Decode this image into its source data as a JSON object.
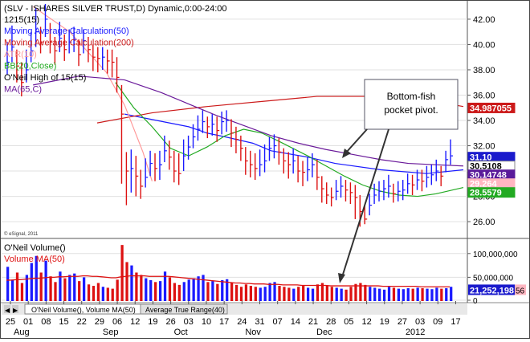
{
  "chart_data": {
    "type": "line",
    "title": "(SLV - ISHARES SILVER TRUST,D) Dynamic,0:00-24:00",
    "header_line2": "1215(15)",
    "price_axis": {
      "min": 24.8,
      "max": 43.2,
      "ticks": [
        "42.00",
        "40.00",
        "38.00",
        "36.00",
        "34.00",
        "32.00",
        "30.00",
        "28.00",
        "26.00"
      ],
      "tick_values": [
        42,
        40,
        38,
        36,
        34,
        32,
        30,
        28,
        26
      ]
    },
    "volume_axis": {
      "min": 0,
      "max": 125000000,
      "ticks": [
        "100,000,000",
        "50,000,000",
        "0"
      ],
      "tick_values": [
        100000000,
        50000000,
        0
      ]
    },
    "x_day_labels": [
      "25",
      "01",
      "08",
      "15",
      "22",
      "29",
      "06",
      "12",
      "19",
      "26",
      "03",
      "10",
      "17",
      "24",
      "31",
      "07",
      "14",
      "21",
      "28",
      "05",
      "12",
      "19",
      "27",
      "03",
      "09",
      "17"
    ],
    "x_month_labels": [
      "Aug",
      "Sep",
      "Oct",
      "Nov",
      "Dec",
      "2012"
    ],
    "x_month_label_slots": [
      0,
      5,
      9,
      13,
      17,
      22
    ],
    "legend": [
      {
        "name": "Moving Average Calculation(50)",
        "color": "#1a1aff"
      },
      {
        "name": "Moving Average Calculation(200)",
        "color": "#cc1a1a"
      },
      {
        "name": "ATR(10)",
        "color": "#ff9999"
      },
      {
        "name": "BB(20,Close)",
        "color": "#22aa22"
      },
      {
        "name": "O'Neil High of 15(15)",
        "color": "#000000"
      },
      {
        "name": "MA(65,C)",
        "color": "#6a1a9a"
      }
    ],
    "series": [
      {
        "name": "Moving Average Calculation(50)",
        "color": "#1a1aff",
        "x": [
          26,
          40,
          44,
          48,
          54,
          58,
          66,
          72,
          82,
          92,
          100
        ],
        "y": [
          34.5,
          33.5,
          33.0,
          32.7,
          32.2,
          31.6,
          31.1,
          30.6,
          30.1,
          29.8,
          30.1
        ]
      },
      {
        "name": "Moving Average Calculation(200)",
        "color": "#cc1a1a",
        "x": [
          20,
          32,
          44,
          56,
          68,
          80,
          92,
          100
        ],
        "y": [
          33.8,
          34.6,
          35.1,
          35.5,
          35.9,
          35.9,
          35.6,
          35.1
        ]
      },
      {
        "name": "ATR(10)",
        "color": "#ff9999",
        "x": [
          6,
          14,
          22,
          26,
          30,
          32
        ],
        "y": [
          43.0,
          41.0,
          37.8,
          35.2,
          31.5,
          29.2
        ]
      },
      {
        "name": "BB(20,Close)",
        "color": "#22aa22",
        "x": [
          24,
          28,
          32,
          36,
          40,
          44,
          48,
          52,
          56,
          60,
          66,
          70,
          74,
          78,
          82,
          86,
          90,
          94,
          100
        ],
        "y": [
          37.0,
          35.0,
          33.5,
          31.8,
          31.2,
          31.9,
          32.8,
          33.3,
          33.0,
          32.3,
          31.2,
          30.4,
          29.6,
          28.9,
          28.4,
          28.1,
          28.0,
          28.2,
          28.7
        ]
      },
      {
        "name": "MA(65,C)",
        "color": "#6a1a9a",
        "x": [
          6,
          16,
          26,
          34,
          40,
          46,
          52,
          58,
          64,
          70,
          76,
          82,
          88,
          94,
          100
        ],
        "y": [
          36.8,
          37.5,
          37.2,
          36.2,
          35.3,
          34.4,
          33.6,
          32.8,
          32.2,
          31.7,
          31.3,
          30.9,
          30.6,
          30.5,
          30.4
        ]
      }
    ],
    "price_bars": {
      "x": [
        0,
        1,
        2,
        3,
        4,
        5,
        6,
        7,
        8,
        9,
        10,
        11,
        12,
        13,
        14,
        15,
        16,
        17,
        18,
        19,
        20,
        21,
        22,
        23,
        24,
        25,
        26,
        27,
        28,
        29,
        30,
        31,
        32,
        33,
        34,
        35,
        36,
        37,
        38,
        39,
        40,
        41,
        42,
        43,
        44,
        45,
        46,
        47,
        48,
        49,
        50,
        51,
        52,
        53,
        54,
        55,
        56,
        57,
        58,
        59,
        60,
        61,
        62,
        63,
        64,
        65,
        66,
        67,
        68,
        69,
        70,
        71,
        72,
        73,
        74,
        75,
        76,
        77,
        78,
        79,
        80,
        81,
        82,
        83,
        84,
        85,
        86,
        87,
        88,
        89,
        90,
        91,
        92,
        93,
        94,
        95,
        96,
        97,
        98,
        99,
        100
      ],
      "close": [
        38.6,
        39.8,
        38.3,
        37.0,
        38.0,
        39.5,
        41.0,
        40.2,
        42.0,
        40.2,
        39.5,
        40.5,
        39.6,
        40.2,
        40.4,
        39.2,
        40.3,
        39.6,
        39.0,
        38.9,
        39.0,
        38.7,
        38.6,
        37.4,
        34.5,
        30.0,
        30.2,
        29.6,
        28.8,
        29.5,
        30.6,
        30.2,
        30.5,
        31.6,
        31.1,
        30.0,
        29.8,
        31.2,
        31.9,
        32.7,
        33.3,
        33.9,
        33.5,
        33.7,
        33.2,
        33.9,
        34.0,
        33.0,
        32.5,
        31.8,
        30.8,
        30.5,
        30.2,
        30.5,
        30.8,
        31.8,
        32.0,
        31.5,
        30.8,
        30.5,
        30.8,
        30.0,
        29.9,
        30.1,
        30.5,
        29.5,
        28.6,
        28.1,
        27.9,
        28.4,
        28.8,
        28.5,
        28.3,
        27.9,
        26.8,
        26.2,
        27.3,
        28.1,
        28.4,
        28.6,
        28.8,
        28.2,
        28.4,
        28.5,
        29.0,
        28.9,
        29.3,
        29.2,
        29.5,
        29.7,
        30.0,
        29.6,
        30.9,
        31.2
      ],
      "high": [
        40.2,
        41.5,
        39.6,
        38.6,
        39.6,
        41.0,
        42.9,
        41.4,
        43.2,
        41.7,
        40.6,
        41.8,
        40.8,
        41.2,
        41.4,
        40.4,
        41.2,
        40.6,
        40.0,
        39.8,
        39.8,
        39.6,
        39.6,
        39.0,
        36.8,
        31.5,
        31.7,
        31.2,
        30.1,
        31.0,
        31.6,
        31.4,
        31.6,
        32.8,
        32.4,
        31.6,
        31.4,
        32.5,
        32.8,
        33.7,
        34.4,
        34.8,
        34.3,
        34.5,
        34.3,
        34.7,
        34.8,
        34.1,
        33.5,
        32.8,
        31.9,
        31.6,
        31.4,
        31.7,
        32.1,
        32.7,
        32.9,
        32.6,
        31.8,
        31.5,
        31.8,
        31.2,
        30.8,
        31.1,
        31.4,
        30.9,
        29.6,
        29.1,
        28.7,
        29.3,
        29.6,
        29.3,
        29.1,
        28.9,
        28.1,
        27.3,
        28.2,
        29.0,
        29.2,
        29.3,
        29.7,
        29.0,
        29.2,
        29.3,
        29.8,
        29.7,
        30.1,
        30.1,
        30.4,
        30.5,
        30.9,
        30.4,
        31.6,
        32.5
      ],
      "low": [
        37.6,
        38.6,
        37.0,
        35.9,
        37.0,
        38.6,
        39.8,
        39.3,
        40.6,
        39.3,
        38.4,
        39.4,
        38.7,
        39.3,
        39.4,
        38.3,
        39.3,
        38.6,
        37.9,
        37.8,
        38.0,
        37.7,
        37.4,
        36.2,
        29.0,
        27.3,
        28.3,
        28.0,
        27.8,
        28.7,
        29.6,
        29.2,
        29.3,
        30.7,
        30.1,
        29.1,
        28.9,
        30.0,
        30.9,
        31.8,
        32.4,
        33.0,
        32.6,
        32.8,
        32.3,
        32.9,
        33.1,
        31.9,
        31.4,
        30.8,
        29.7,
        29.5,
        29.3,
        29.6,
        29.9,
        30.8,
        31.0,
        30.5,
        29.8,
        29.4,
        29.8,
        29.1,
        28.8,
        29.2,
        29.5,
        28.5,
        27.5,
        27.4,
        27.2,
        27.7,
        27.9,
        27.6,
        27.4,
        26.2,
        25.6,
        25.8,
        26.5,
        27.4,
        27.6,
        27.7,
        27.9,
        27.5,
        27.6,
        27.7,
        28.2,
        28.1,
        28.5,
        28.4,
        28.7,
        28.9,
        29.2,
        28.8,
        29.9,
        30.5
      ],
      "color": [
        "#1a1aff",
        "#1a1aff",
        "#dd1111",
        "#dd1111",
        "#1a1aff",
        "#1a1aff",
        "#1a1aff",
        "#dd1111",
        "#1a1aff",
        "#dd1111",
        "#dd1111",
        "#1a1aff",
        "#dd1111",
        "#1a1aff",
        "#1a1aff",
        "#dd1111",
        "#1a1aff",
        "#dd1111",
        "#dd1111",
        "#dd1111",
        "#1a1aff",
        "#dd1111",
        "#dd1111",
        "#dd1111",
        "#dd1111",
        "#dd1111",
        "#1a1aff",
        "#dd1111",
        "#dd1111",
        "#1a1aff",
        "#1a1aff",
        "#dd1111",
        "#1a1aff",
        "#1a1aff",
        "#dd1111",
        "#dd1111",
        "#dd1111",
        "#1a1aff",
        "#1a1aff",
        "#1a1aff",
        "#1a1aff",
        "#1a1aff",
        "#dd1111",
        "#1a1aff",
        "#dd1111",
        "#1a1aff",
        "#1a1aff",
        "#dd1111",
        "#dd1111",
        "#dd1111",
        "#dd1111",
        "#dd1111",
        "#dd1111",
        "#1a1aff",
        "#1a1aff",
        "#1a1aff",
        "#1a1aff",
        "#dd1111",
        "#dd1111",
        "#dd1111",
        "#1a1aff",
        "#dd1111",
        "#dd1111",
        "#1a1aff",
        "#1a1aff",
        "#dd1111",
        "#dd1111",
        "#dd1111",
        "#dd1111",
        "#1a1aff",
        "#1a1aff",
        "#dd1111",
        "#dd1111",
        "#dd1111",
        "#dd1111",
        "#dd1111",
        "#1a1aff",
        "#1a1aff",
        "#1a1aff",
        "#1a1aff",
        "#1a1aff",
        "#dd1111",
        "#1a1aff",
        "#1a1aff",
        "#1a1aff",
        "#dd1111",
        "#1a1aff",
        "#dd1111",
        "#1a1aff",
        "#1a1aff",
        "#1a1aff",
        "#dd1111",
        "#1a1aff",
        "#1a1aff"
      ]
    },
    "volume_bars": {
      "values": [
        72,
        45,
        60,
        38,
        55,
        80,
        95,
        60,
        85,
        52,
        40,
        62,
        48,
        55,
        58,
        42,
        50,
        35,
        32,
        38,
        30,
        28,
        26,
        45,
        118,
        82,
        75,
        60,
        55,
        48,
        44,
        40,
        42,
        62,
        50,
        38,
        34,
        40,
        45,
        48,
        52,
        55,
        40,
        42,
        36,
        44,
        46,
        38,
        34,
        30,
        35,
        32,
        30,
        28,
        30,
        38,
        40,
        32,
        30,
        28,
        26,
        30,
        32,
        28,
        26,
        35,
        38,
        33,
        30,
        28,
        26,
        24,
        30,
        36,
        38,
        34,
        30,
        28,
        26,
        24,
        30,
        28,
        26,
        25,
        27,
        26,
        28,
        27,
        26,
        25,
        28,
        26,
        27,
        30
      ],
      "unit_millions": true,
      "ma50": [
        44,
        44,
        45,
        45,
        46,
        47,
        48,
        48,
        49,
        50,
        50,
        51,
        51,
        52,
        52,
        52,
        53,
        53,
        52,
        52,
        51,
        50,
        49,
        49,
        51,
        52,
        53,
        53,
        53,
        53,
        52,
        52,
        52,
        52,
        52,
        51,
        50,
        49,
        48,
        47,
        46,
        45,
        44,
        43,
        42,
        41,
        40,
        39,
        38,
        38,
        37,
        37,
        36,
        36,
        36,
        35,
        35,
        35,
        34,
        34,
        34,
        34,
        33,
        33,
        33,
        33,
        33,
        33,
        32,
        32,
        32,
        32,
        32,
        32,
        32,
        32,
        32,
        32,
        32,
        31,
        31,
        31,
        31,
        31,
        31,
        31,
        31,
        30,
        30,
        30,
        30,
        30,
        30,
        30
      ]
    },
    "price_badges": [
      {
        "text": "34.987055",
        "bg": "#cc1a1a",
        "fg": "#ffffff",
        "value": 34.987
      },
      {
        "text": "31.10",
        "bg": "#1a1acc",
        "fg": "#ffffff",
        "value": 31.1
      },
      {
        "text": "30.5108",
        "bg": "#ffffff",
        "fg": "#000000",
        "value": 30.51
      },
      {
        "text": "30.14748",
        "bg": "#5a1a9a",
        "fg": "#ffffff",
        "value": 30.147
      },
      {
        "text": "29.264",
        "bg": "#ffb6c1",
        "fg": "#ffffff",
        "value": 29.264
      },
      {
        "text": "28.5579",
        "bg": "#22aa22",
        "fg": "#ffffff",
        "value": 28.558
      }
    ],
    "volume_badge": {
      "text": "21,252,198",
      "suffix": "56",
      "bg": "#1a1acc",
      "fg": "#ffffff",
      "value": 21252198
    },
    "volume_title": "O'Neil Volume()",
    "volume_legend": "Volume MA(50)",
    "tabs": [
      "O'Neil Volume(), Volume MA(50)",
      "Average True Range(40)"
    ],
    "watermark": "© eSignal, 2011",
    "annotation": {
      "text": [
        "Bottom-fish",
        "pocket pivot."
      ]
    }
  }
}
